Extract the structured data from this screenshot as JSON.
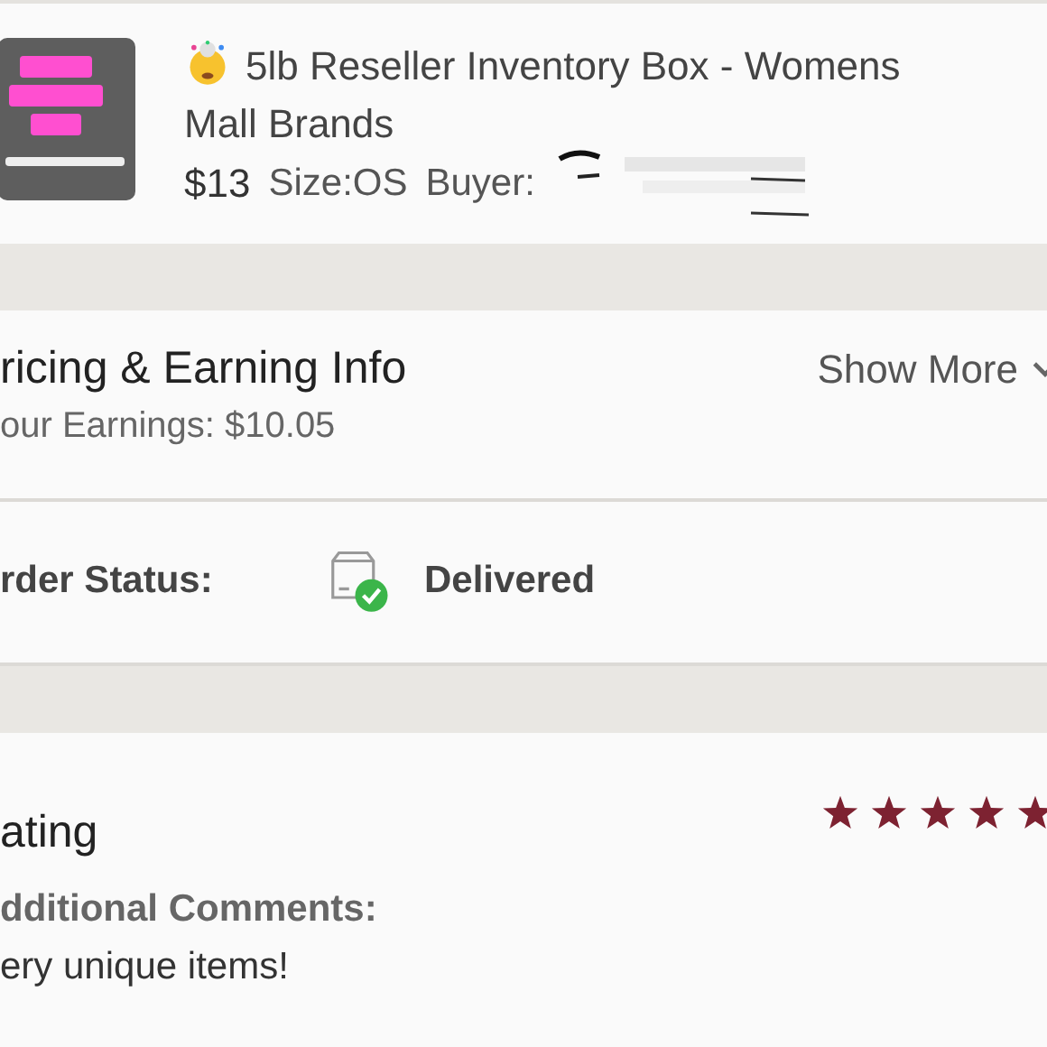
{
  "product": {
    "title": "5lb Reseller Inventory Box - Womens Mall Brands",
    "price": "$13",
    "size": "Size:OS",
    "buyer_label": "Buyer:"
  },
  "pricing": {
    "heading": "ricing & Earning Info",
    "earnings": "our Earnings: $10.05",
    "toggle": "Show More"
  },
  "order_status": {
    "label": "rder Status:",
    "status": "Delivered"
  },
  "rating": {
    "heading": "ating",
    "stars": 5,
    "comments_label": "dditional Comments:",
    "comment": "ery unique items!"
  }
}
